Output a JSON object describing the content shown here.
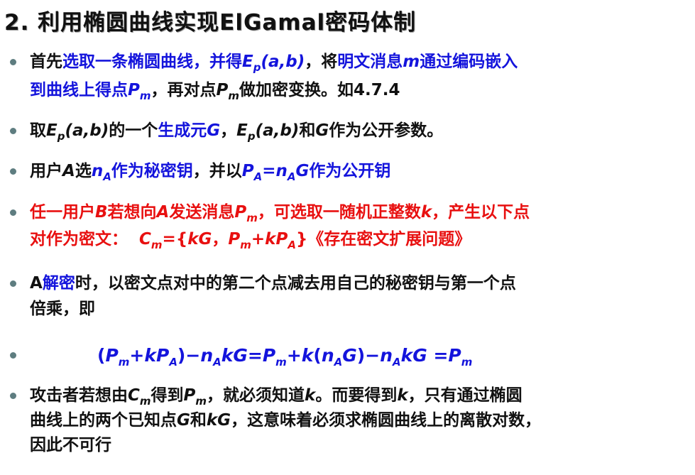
{
  "title": "2. 利用椭圆曲线实现ElGamal密码体制",
  "colors": {
    "blue": "#1414dc",
    "red": "#e81010",
    "text": "#111111",
    "bullet": "#5e7d80"
  },
  "b1": {
    "t1": "首先",
    "t2": "选取一条椭圆曲线，并得",
    "E": "E",
    "p": "p",
    "ab": "(a,b)",
    "t3": "，将",
    "t4": "明文消息",
    "m": "m",
    "t5": "通过编码嵌入",
    "t6": "到曲线上得点",
    "P": "P",
    "m2": "m",
    "t7": "，再对点",
    "P2": "P",
    "m3": "m",
    "t8": "做加密变换。如4.7.4"
  },
  "b2": {
    "t1": "取",
    "E": "E",
    "p": "p",
    "ab": "(a,b)",
    "t2": "的一个",
    "t3": "生成元",
    "G": "G",
    "t4": "，",
    "E2": "E",
    "p2": "p",
    "ab2": "(a,b)",
    "t5": "和",
    "G2": "G",
    "t6": "作为公开参数。"
  },
  "b3": {
    "t1": "用户",
    "A": "A",
    "t2": "选",
    "n": "n",
    "a": "A",
    "t3": "作为秘密钥",
    "t4": "，并以",
    "P": "P",
    "pa": "A",
    "eq": "=",
    "n2": "n",
    "a2": "A",
    "G": "G",
    "t5": "作为公开钥"
  },
  "b4": {
    "t1": "任一用户",
    "B": "B",
    "t2": "若想向",
    "A": "A",
    "t3": "发送消息",
    "P": "P",
    "m": "m",
    "t4": "，可选取一随机正整数",
    "k": "k",
    "t5": "，产生以下点",
    "t6": "对作为密文：",
    "C": "C",
    "cm": "m",
    "t7": "={",
    "kG": "kG",
    "t8": "，",
    "P2": "P",
    "m2": "m",
    "t9": "+",
    "kP": "kP",
    "pa": "A",
    "t10": "}《存在密文扩展问题》"
  },
  "b5": {
    "t1": "A",
    "t2": "解密",
    "t3": "时，以密文点对中的第二个点减去用自己的秘密钥与第一个点",
    "t4": "倍乘，即"
  },
  "b6": {
    "lp": "(",
    "P": "P",
    "m": "m",
    "pl": "+",
    "kP": "kP",
    "a": "A",
    "rp": ")",
    "mi": "−",
    "n": "n",
    "a2": "A",
    "kG": "kG",
    "eq": "=",
    "P2": "P",
    "m2": "m",
    "pl2": "+",
    "k": "k",
    "lp2": "(",
    "n2": "n",
    "a3": "A",
    "G": "G",
    "rp2": ")",
    "mi2": "−",
    "n3": "n",
    "a4": "A",
    "kG2": "kG",
    "eq2": " =",
    "P3": "P",
    "m3": "m"
  },
  "b7": {
    "t1": "攻击者若想由",
    "C": "C",
    "m": "m",
    "t2": "得到",
    "P": "P",
    "m2": "m",
    "t3": "，就必须知道",
    "k": "k",
    "t4": "。而要得到",
    "k2": "k",
    "t5": "，只有通过椭圆",
    "t6": "曲线上的两个已知点",
    "G": "G",
    "t7": "和",
    "kG": "kG",
    "t8": "，这意味着必须求椭圆曲线上的离散对数，",
    "t9": "因此不可行"
  }
}
